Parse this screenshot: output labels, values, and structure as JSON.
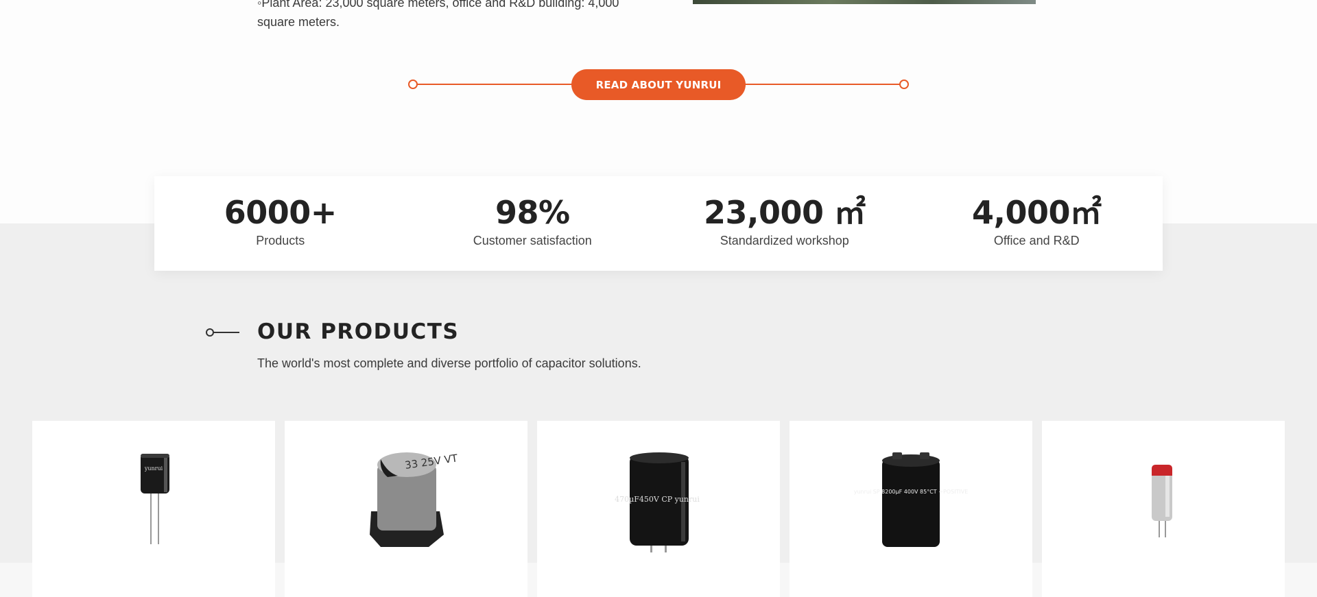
{
  "about": {
    "text": "◦Plant Area: 23,000 square meters, office and R&D building: 4,000 square meters."
  },
  "read_button": {
    "label": "READ ABOUT YUNRUI"
  },
  "stats": [
    {
      "value": "6000+",
      "label": "Products"
    },
    {
      "value": "98%",
      "label": "Customer satisfaction"
    },
    {
      "value": "23,000 ㎡",
      "label": "Standardized workshop"
    },
    {
      "value": "4,000㎡",
      "label": "Office and R&D"
    }
  ],
  "products_section": {
    "title": "OUR PRODUCTS",
    "subtitle": "The world's most complete and diverse portfolio of capacitor solutions."
  },
  "product_cards": [
    {
      "icon": "radial-capacitor-icon",
      "marking": "yunrui"
    },
    {
      "icon": "smd-capacitor-icon",
      "marking": "33 25V VT"
    },
    {
      "icon": "snap-in-capacitor-icon",
      "marking": "470µF450V CP yunrui"
    },
    {
      "icon": "screw-terminal-capacitor-icon",
      "marking": "yunrui SP 8200µF 400V 85°CT +POSITIVE"
    },
    {
      "icon": "polymer-capacitor-icon",
      "marking": ""
    }
  ],
  "colors": {
    "accent": "#e85a27",
    "section_bg": "#efefef",
    "text_dark": "#232323"
  }
}
